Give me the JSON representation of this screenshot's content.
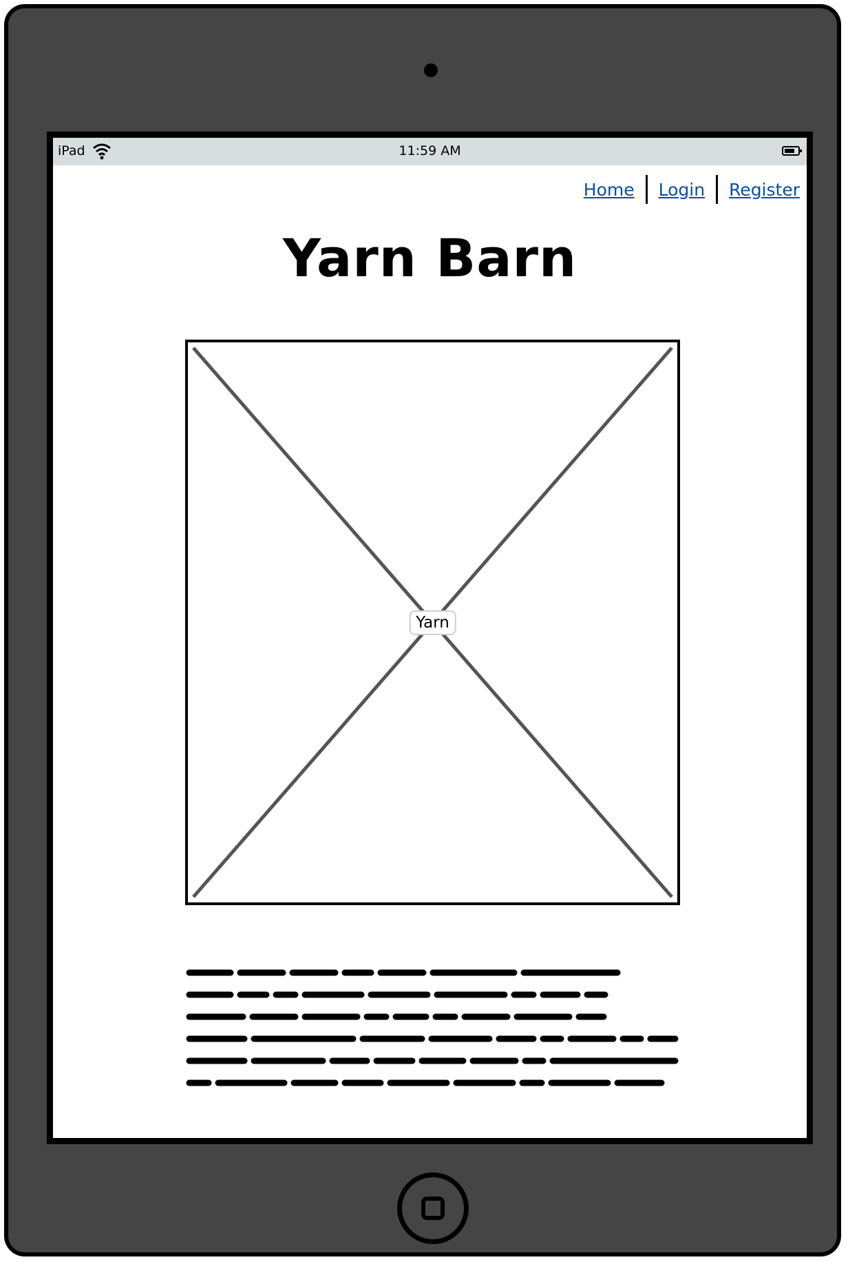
{
  "status_bar": {
    "device": "iPad",
    "time": "11:59 AM"
  },
  "nav": {
    "home": "Home",
    "login": "Login",
    "register": "Register"
  },
  "page": {
    "title": "Yarn Barn",
    "image_label": "Yarn"
  },
  "icons": {
    "wifi": "wifi-icon",
    "battery": "battery-icon",
    "camera": "camera-icon",
    "home_button": "home-button-icon"
  },
  "colors": {
    "device_frame": "#454545",
    "status_bar": "#d8dde0",
    "link": "#0b4f9e"
  }
}
